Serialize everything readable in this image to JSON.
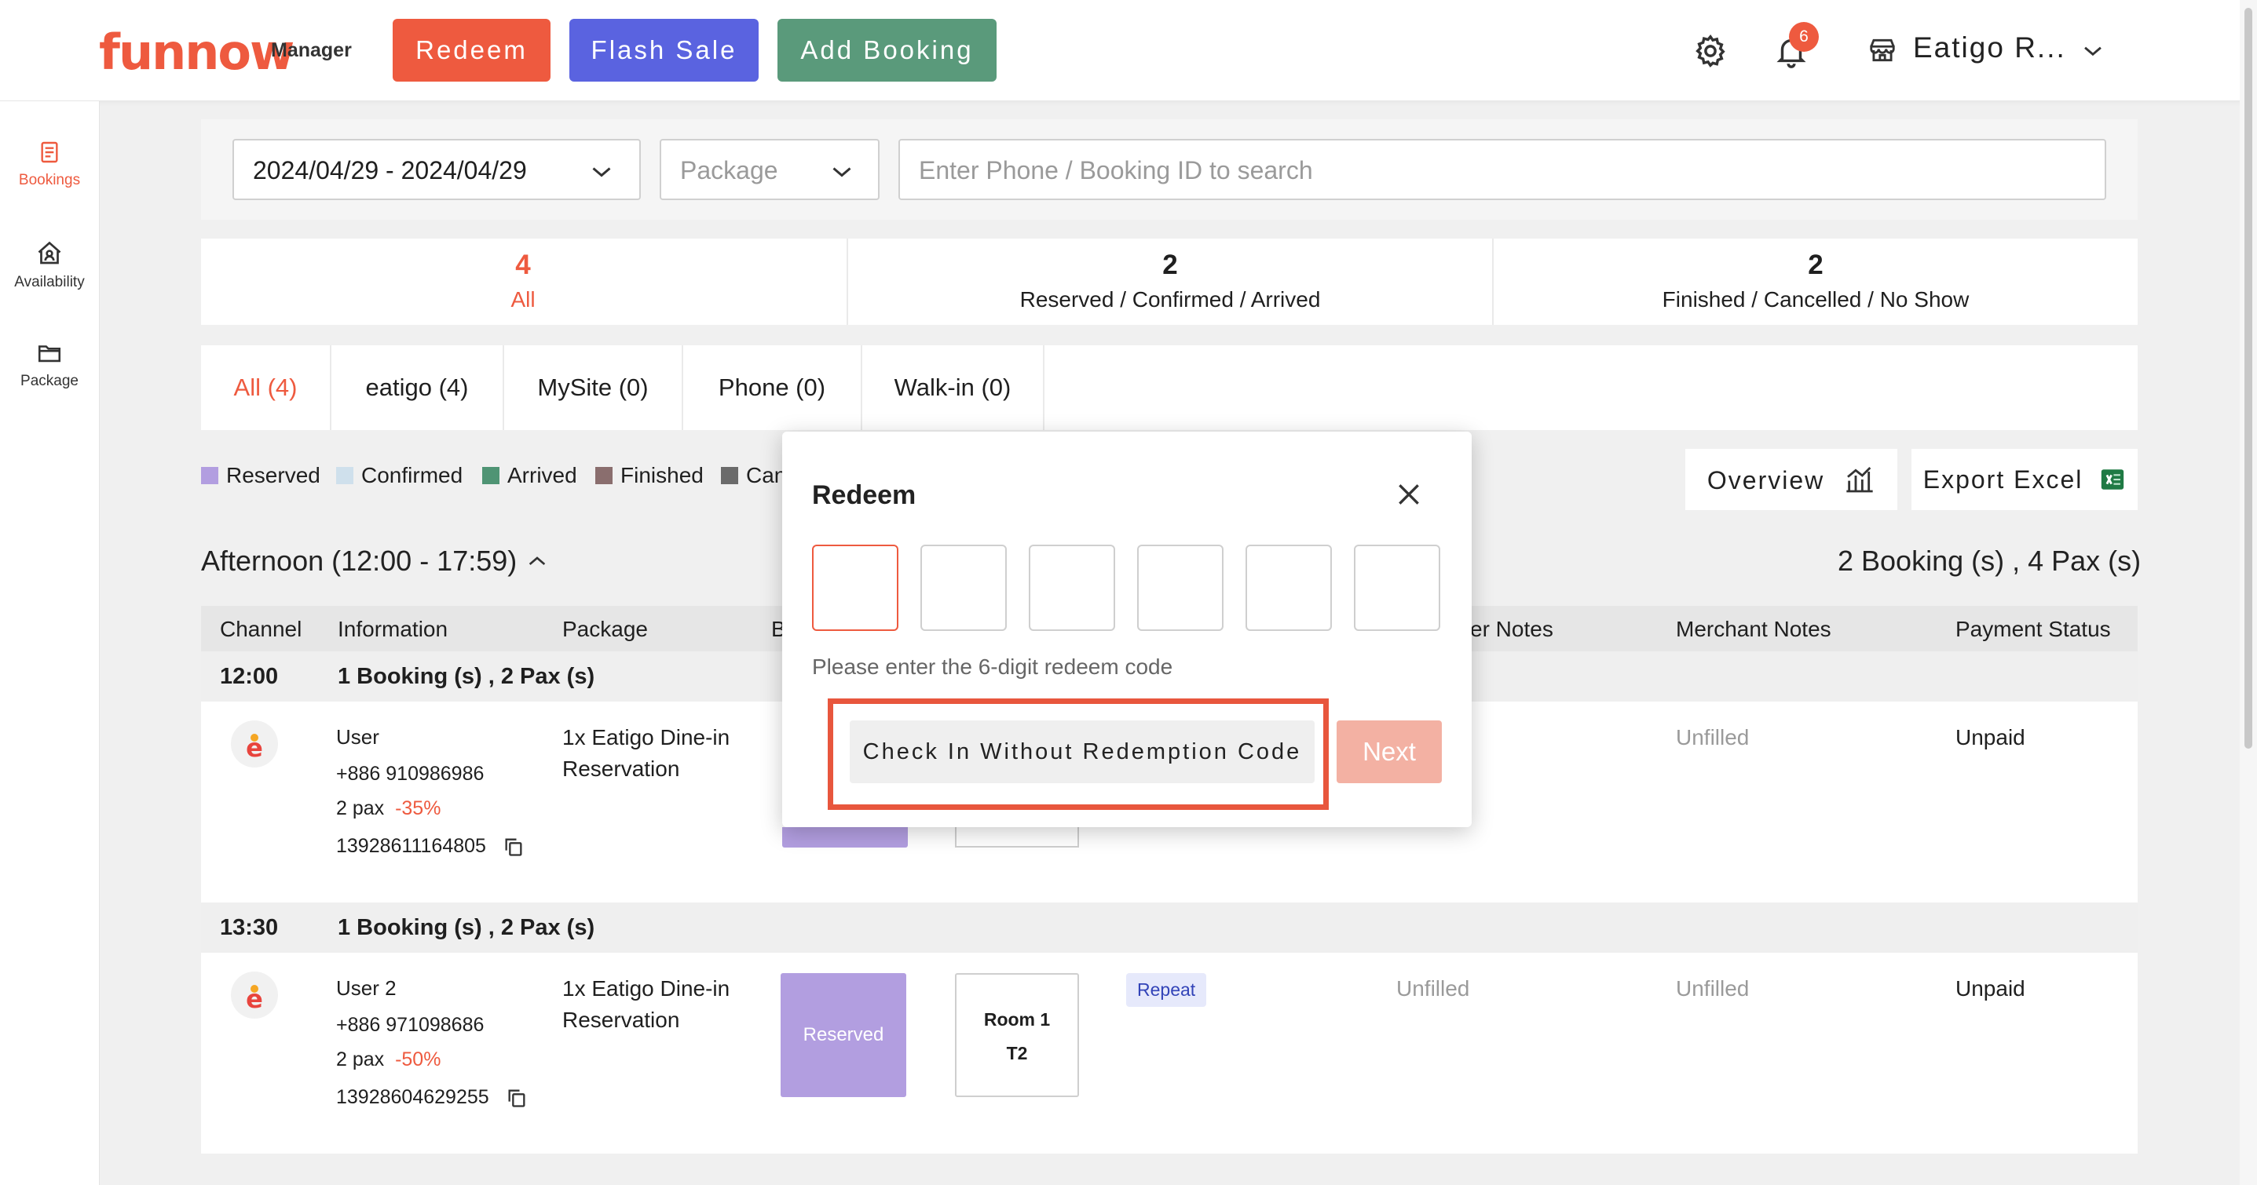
{
  "header": {
    "logo_text": "funnow",
    "logo_sub": "Manager",
    "redeem_label": "Redeem",
    "flash_sale_label": "Flash Sale",
    "add_booking_label": "Add Booking",
    "notification_count": "6",
    "store_name": "Eatigo R..."
  },
  "sidebar": {
    "items": [
      {
        "label": "Bookings"
      },
      {
        "label": "Availability"
      },
      {
        "label": "Package"
      }
    ]
  },
  "filters": {
    "date_range": "2024/04/29 - 2024/04/29",
    "package_placeholder": "Package",
    "search_placeholder": "Enter Phone / Booking ID to search"
  },
  "stats": [
    {
      "count": "4",
      "label": "All"
    },
    {
      "count": "2",
      "label": "Reserved / Confirmed / Arrived"
    },
    {
      "count": "2",
      "label": "Finished / Cancelled / No Show"
    }
  ],
  "channels": [
    {
      "label": "All (4)"
    },
    {
      "label": "eatigo (4)"
    },
    {
      "label": "MySite (0)"
    },
    {
      "label": "Phone (0)"
    },
    {
      "label": "Walk-in (0)"
    }
  ],
  "legend": [
    {
      "label": "Reserved",
      "color": "#b29ee0"
    },
    {
      "label": "Confirmed",
      "color": "#cfe0ec"
    },
    {
      "label": "Arrived",
      "color": "#4f9474"
    },
    {
      "label": "Finished",
      "color": "#8a6e6e"
    },
    {
      "label": "Can",
      "color": "#6b6b6b"
    }
  ],
  "toolbar": {
    "overview_label": "Overview",
    "export_label": "Export Excel"
  },
  "section": {
    "title": "Afternoon (12:00 - 17:59)",
    "summary": "2 Booking (s) , 4 Pax (s)"
  },
  "table": {
    "headers": [
      "Channel",
      "Information",
      "Package",
      "B",
      "er Notes",
      "Merchant Notes",
      "Payment Status"
    ]
  },
  "slots": [
    {
      "time": "12:00",
      "summary": "1 Booking (s) , 2 Pax (s)",
      "booking": {
        "name": "User",
        "phone": "+886 910986986",
        "pax": "2 pax",
        "discount": "-35%",
        "booking_id": "13928611164805",
        "package": "1x Eatigo Dine-in",
        "package_line2": "Reservation",
        "merchant_notes": "Unfilled",
        "payment_status": "Unpaid"
      }
    },
    {
      "time": "13:30",
      "summary": "1 Booking (s) , 2 Pax (s)",
      "booking": {
        "name": "User 2",
        "phone": "+886 971098686",
        "pax": "2 pax",
        "discount": "-50%",
        "booking_id": "13928604629255",
        "package": "1x Eatigo Dine-in",
        "package_line2": "Reservation",
        "status": "Reserved",
        "room": "Room 1",
        "table": "T2",
        "tag": "Repeat",
        "customer_notes": "Unfilled",
        "merchant_notes": "Unfilled",
        "payment_status": "Unpaid"
      }
    }
  ],
  "modal": {
    "title": "Redeem",
    "hint": "Please enter the 6-digit redeem code",
    "checkin_label": "Check In Without Redemption Code",
    "next_label": "Next"
  },
  "colors": {
    "brand": "#ee5a3f",
    "flash": "#5a63e0",
    "add": "#5a9a7b"
  }
}
